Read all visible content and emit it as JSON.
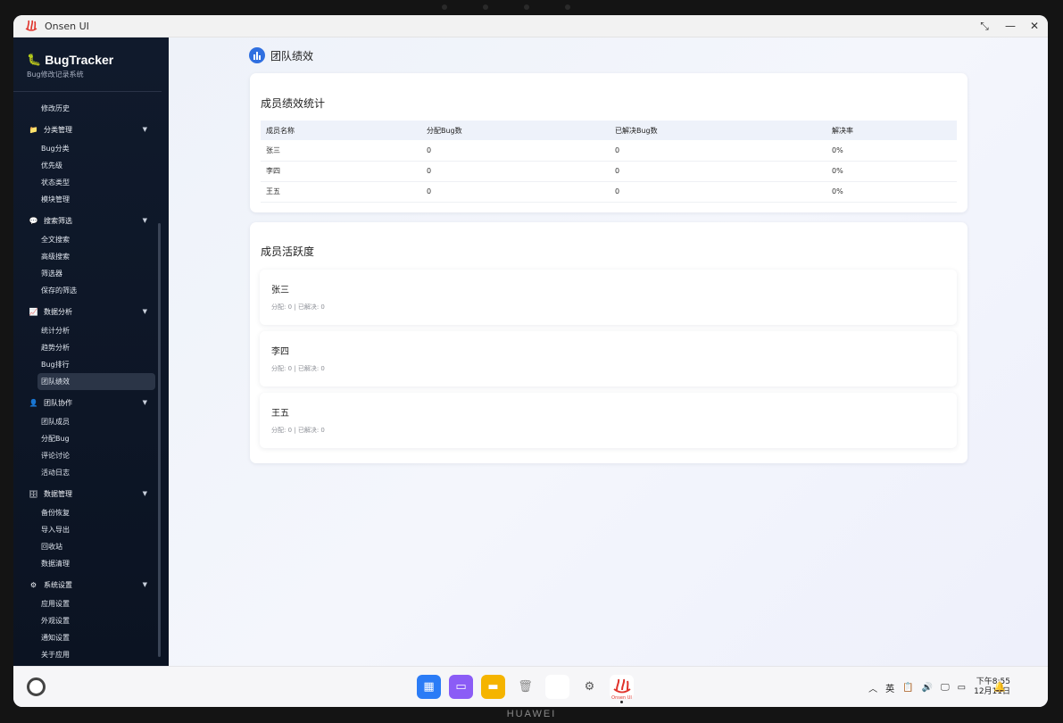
{
  "window": {
    "title": "Onsen UI",
    "controls": [
      "shrink-icon",
      "minimize-icon",
      "close-icon"
    ]
  },
  "sidebar": {
    "app_name": "BugTracker",
    "app_subtitle": "Bug修改记录系统",
    "top_item": "修改历史",
    "groups": [
      {
        "label": "分类管理",
        "icon": "folder-icon",
        "items": [
          "Bug分类",
          "优先级",
          "状态类型",
          "模块管理"
        ]
      },
      {
        "label": "搜索筛选",
        "icon": "search-bubble-icon",
        "items": [
          "全文搜索",
          "高级搜索",
          "筛选器",
          "保存的筛选"
        ]
      },
      {
        "label": "数据分析",
        "icon": "chart-icon",
        "items": [
          "统计分析",
          "趋势分析",
          "Bug排行",
          "团队绩效"
        ]
      },
      {
        "label": "团队协作",
        "icon": "people-icon",
        "items": [
          "团队成员",
          "分配Bug",
          "评论讨论",
          "活动日志"
        ]
      },
      {
        "label": "数据管理",
        "icon": "database-icon",
        "items": [
          "备份恢复",
          "导入导出",
          "回收站",
          "数据清理"
        ]
      },
      {
        "label": "系统设置",
        "icon": "gear-icon",
        "items": [
          "应用设置",
          "外观设置",
          "通知设置",
          "关于应用"
        ]
      }
    ],
    "active_item": "团队绩效"
  },
  "page": {
    "title": "团队绩效",
    "stats_card": {
      "title": "成员绩效统计",
      "columns": [
        "成员名称",
        "分配Bug数",
        "已解决Bug数",
        "解决率"
      ],
      "rows": [
        [
          "张三",
          "0",
          "0",
          "0%"
        ],
        [
          "李四",
          "0",
          "0",
          "0%"
        ],
        [
          "王五",
          "0",
          "0",
          "0%"
        ]
      ]
    },
    "activity_card": {
      "title": "成员活跃度",
      "members": [
        {
          "name": "张三",
          "stats": "分配: 0 | 已解决: 0"
        },
        {
          "name": "李四",
          "stats": "分配: 0 | 已解决: 0"
        },
        {
          "name": "王五",
          "stats": "分配: 0 | 已解决: 0"
        }
      ]
    }
  },
  "taskbar": {
    "dock_apps": [
      "app-grid-icon",
      "window-switch-icon",
      "files-icon",
      "trash-icon",
      "gallery-icon",
      "settings-icon",
      "onsen-app-icon"
    ],
    "onsen_label": "Onsen UI",
    "tray": {
      "ime": "英",
      "time": "下午8:55",
      "date": "12月11日"
    }
  },
  "device_brand": "HUAWEI",
  "colors": {
    "sidebar_bg": "#0d1626",
    "accent": "#2f6fe0",
    "active_nav": "#2b3547"
  }
}
